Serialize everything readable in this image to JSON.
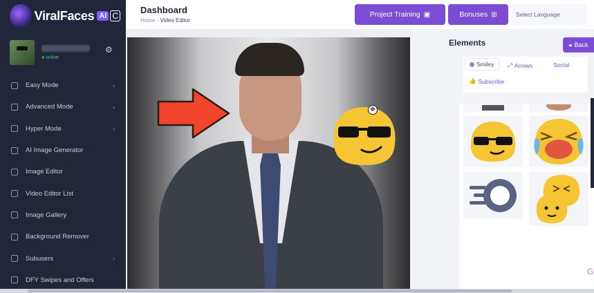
{
  "brand": {
    "name": "ViralFaces",
    "ai_badge": "AI",
    "badge2": "C"
  },
  "user": {
    "status": "online"
  },
  "sidebar": {
    "items": [
      {
        "label": "Easy Mode",
        "icon": "easy-mode-icon",
        "chevron": true
      },
      {
        "label": "Advanced Mode",
        "icon": "advanced-mode-icon",
        "chevron": true
      },
      {
        "label": "Hyper Mode",
        "icon": "hyper-mode-icon",
        "chevron": true
      },
      {
        "label": "AI Image Generator",
        "icon": "ai-image-icon",
        "chevron": false
      },
      {
        "label": "Image Editor",
        "icon": "image-editor-icon",
        "chevron": false
      },
      {
        "label": "Video Editor List",
        "icon": "video-list-icon",
        "chevron": false
      },
      {
        "label": "Image Gallery",
        "icon": "gallery-icon",
        "chevron": false
      },
      {
        "label": "Background Remover",
        "icon": "bg-remover-icon",
        "chevron": false
      },
      {
        "label": "Subusers",
        "icon": "subusers-icon",
        "chevron": true
      },
      {
        "label": "DFY Swipes and Offers",
        "icon": "swipes-icon",
        "chevron": false
      }
    ]
  },
  "header": {
    "title": "Dashboard",
    "breadcrumb_home": "Home",
    "breadcrumb_sep": "-",
    "breadcrumb_current": "Video Editor",
    "training_label": "Project Training",
    "bonuses_label": "Bonuses",
    "language_placeholder": "Select Language"
  },
  "panel": {
    "title": "Elements",
    "back_label": "Back",
    "tabs": [
      {
        "label": "Smiley",
        "active": true
      },
      {
        "label": "Arrows",
        "active": false
      },
      {
        "label": "Social",
        "active": false
      },
      {
        "label": "Subscribe",
        "active": false
      }
    ]
  },
  "colors": {
    "accent": "#7c4dd4",
    "sidebar_bg": "#22263a",
    "arrow": "#f0452a",
    "emoji": "#f5c533"
  }
}
